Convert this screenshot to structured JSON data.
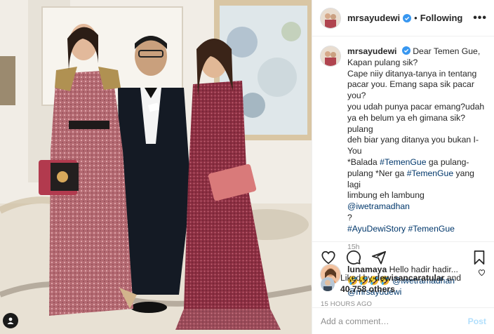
{
  "post": {
    "author": "mrsayudewi",
    "follow_status": "Following",
    "separator": "•",
    "more_label": "•••"
  },
  "caption": {
    "username": "mrsayudewi",
    "lines": [
      "Dear Temen Gue,",
      "Kapan pulang sik?",
      "Cape niiy ditanya-tanya in tentang",
      "pacar you. Emang sapa sik pacar you?",
      "you udah punya pacar emang?udah",
      "ya eh belum ya eh gimana sik?pulang",
      "deh biar yang ditanya you bukan I-",
      "You"
    ],
    "balada_1": "*Balada ",
    "balada_tag": "#TemenGue",
    "balada_2": " ga pulang-",
    "l10_1": "pulang *Ner ga ",
    "l10_tag": "#TemenGue",
    "l10_2": " yang lagi",
    "l11_1": "limbung eh lambung ",
    "l11_mention": "@iwetramadhan",
    "l12": "?",
    "hashtag_1": "#AyuDewiStory",
    "hashtag_2": "#TemenGue",
    "age": "15h"
  },
  "comment": {
    "username": "lunamaya",
    "text": "Hello hadir hadir...",
    "emojis": "🤣🤣🤣🤣",
    "mention_1": "@iwetramadhan",
    "mention_2": "@mrsayudewi"
  },
  "likes": {
    "prefix": "Liked by ",
    "user": "dewisancaratular",
    "and": " and",
    "count": "40,758 others"
  },
  "timestamp": "15 HOURS AGO",
  "add_comment": {
    "placeholder": "Add a comment…",
    "post_label": "Post"
  },
  "colors": {
    "link": "#00376b",
    "verified": "#3897f0",
    "muted": "#8e8e8e",
    "post_disabled": "#b2dffc"
  },
  "icons": [
    "heart-icon",
    "comment-icon",
    "share-icon",
    "bookmark-icon",
    "verified-icon",
    "user-tag-icon"
  ]
}
